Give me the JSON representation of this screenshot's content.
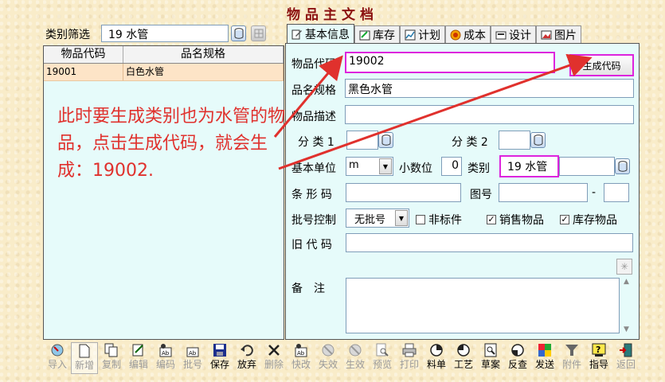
{
  "window_title": "物品主文档",
  "filter": {
    "label": "类别筛选",
    "value": "19 水管"
  },
  "list": {
    "columns": [
      "物品代码",
      "品名规格"
    ],
    "rows": [
      {
        "code": "19001",
        "name": "白色水管"
      }
    ]
  },
  "annotation": "此时要生成类别也为水管的物品，点击生成代码，就会生成：19002.",
  "tabs": [
    "基本信息",
    "库存",
    "计划",
    "成本",
    "设计",
    "图片"
  ],
  "form": {
    "code_label": "物品代码",
    "code_value": "19002",
    "generate_button": "生成代码",
    "name_label": "品名规格",
    "name_value": "黑色水管",
    "desc_label": "物品描述",
    "desc_value": "",
    "cat1_label": "分 类 1",
    "cat1_value": "",
    "cat2_label": "分 类 2",
    "cat2_value": "",
    "unit_label": "基本单位",
    "unit_value": "m",
    "decimals_label": "小数位",
    "decimals_value": "0",
    "category_label": "类别",
    "category_value": "19 水管",
    "barcode_label": "条 形 码",
    "barcode_value": "",
    "drawing_label": "图号",
    "drawing_value": "",
    "drawing_sep": "-",
    "drawing_suffix": "",
    "batch_label": "批号控制",
    "batch_value": "无批号",
    "nonstandard_label": "非标件",
    "nonstandard_checked": false,
    "sales_label": "销售物品",
    "sales_checked": true,
    "stock_label": "库存物品",
    "stock_checked": true,
    "oldcode_label": "旧 代 码",
    "oldcode_value": "",
    "notes_label": "备　注",
    "notes_value": ""
  },
  "toolbar": [
    {
      "label": "导入",
      "icon": "import-icon",
      "enabled": false
    },
    {
      "label": "新增",
      "icon": "new-doc-icon",
      "enabled": false,
      "pressed": true
    },
    {
      "label": "复制",
      "icon": "copy-icon",
      "enabled": false
    },
    {
      "label": "编辑",
      "icon": "edit-icon",
      "enabled": false
    },
    {
      "label": "编码",
      "icon": "code-icon",
      "enabled": false
    },
    {
      "label": "批号",
      "icon": "batch-icon",
      "enabled": false
    },
    {
      "label": "保存",
      "icon": "save-icon",
      "enabled": true
    },
    {
      "label": "放弃",
      "icon": "undo-icon",
      "enabled": true
    },
    {
      "label": "删除",
      "icon": "delete-icon",
      "enabled": false
    },
    {
      "label": "快改",
      "icon": "quick-edit-icon",
      "enabled": false
    },
    {
      "label": "失效",
      "icon": "invalidate-icon",
      "enabled": false
    },
    {
      "label": "生效",
      "icon": "validate-icon",
      "enabled": false
    },
    {
      "label": "预览",
      "icon": "preview-icon",
      "enabled": false
    },
    {
      "label": "打印",
      "icon": "print-icon",
      "enabled": false
    },
    {
      "label": "料单",
      "icon": "bom-icon",
      "enabled": true
    },
    {
      "label": "工艺",
      "icon": "process-icon",
      "enabled": true
    },
    {
      "label": "草案",
      "icon": "draft-icon",
      "enabled": true
    },
    {
      "label": "反查",
      "icon": "reverse-lookup-icon",
      "enabled": true
    },
    {
      "label": "发送",
      "icon": "send-icon",
      "enabled": true
    },
    {
      "label": "附件",
      "icon": "attachment-icon",
      "enabled": false
    },
    {
      "label": "指导",
      "icon": "guide-icon",
      "enabled": true
    },
    {
      "label": "返回",
      "icon": "exit-icon",
      "enabled": false
    }
  ],
  "colors": {
    "title": "#8b1010",
    "annotation": "#e0312d",
    "highlight": "#dd24dd",
    "panel": "#e6fbfa",
    "selected_row": "#fde4c7"
  }
}
